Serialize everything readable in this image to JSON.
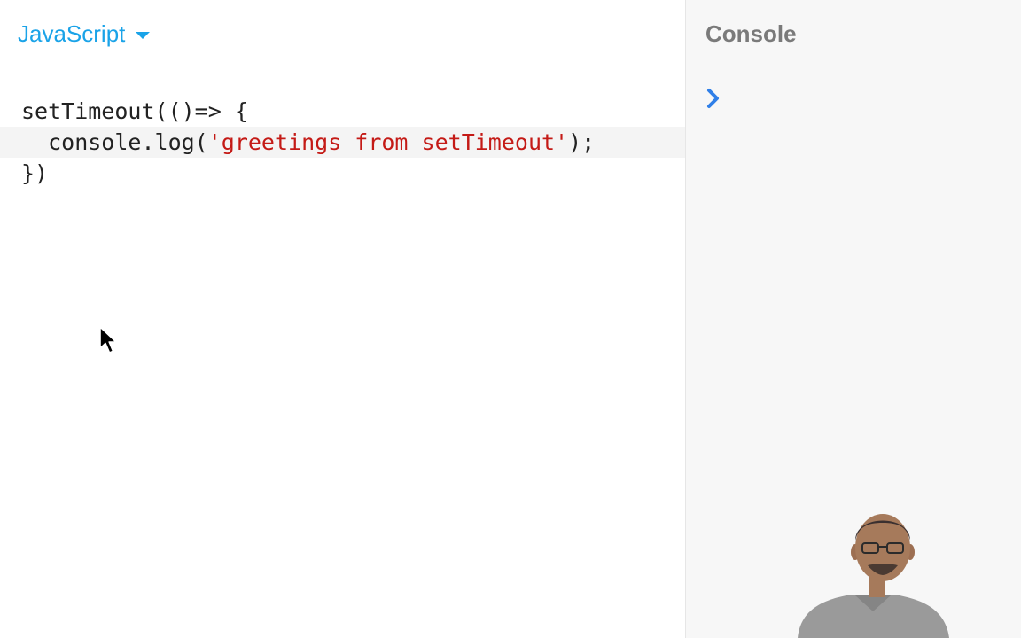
{
  "editor": {
    "language": "JavaScript",
    "code_lines": [
      {
        "parts": [
          {
            "text": "setTimeout(()=> {",
            "kind": "plain"
          }
        ]
      },
      {
        "parts": [
          {
            "text": "  console.log(",
            "kind": "plain"
          },
          {
            "text": "'greetings from setTimeout'",
            "kind": "string"
          },
          {
            "text": ");",
            "kind": "plain"
          }
        ]
      },
      {
        "parts": [
          {
            "text": "})",
            "kind": "plain"
          }
        ]
      }
    ],
    "active_line": 1
  },
  "console": {
    "title": "Console",
    "prompt_icon": "chevron-right-icon"
  },
  "overlay": {
    "cursor_icon": "mouse-pointer-icon",
    "webcam": "presenter-webcam"
  },
  "colors": {
    "accent": "#1aa3e8",
    "prompt": "#2f7fe8",
    "string": "#c41a16",
    "console_title": "#7a7a7a"
  }
}
